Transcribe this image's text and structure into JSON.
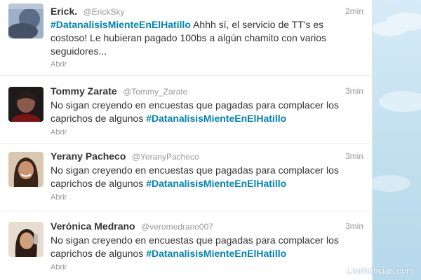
{
  "tweets": [
    {
      "name": "Erick.",
      "handle": "@ErickSky",
      "time": "2min",
      "hashtag": "#DatanalisisMienteEnElHatillo",
      "text_before": "",
      "text_after": " Ahhh sí, el servicio de TT's es costoso! Le hubieran pagado 100bs a algún chamito con varios seguidores...",
      "open_label": "Abrir",
      "avatar_color": "#5b6c86"
    },
    {
      "name": "Tommy Zarate",
      "handle": "@Tommy_Zarate",
      "time": "3min",
      "hashtag": "#DatanalisisMienteEnElHatillo",
      "text_before": "No sigan creyendo en encuestas que pagadas para complacer los caprichos de algunos ",
      "text_after": "",
      "open_label": "Abrir",
      "avatar_color": "#3b2a24"
    },
    {
      "name": "Yerany Pacheco",
      "handle": "@YeranyPacheco",
      "time": "3min",
      "hashtag": "#DatanalisisMienteEnElHatillo",
      "text_before": "No sigan creyendo en encuestas que pagadas para complacer los caprichos de algunos ",
      "text_after": "",
      "open_label": "Abrir",
      "avatar_color": "#a9774f"
    },
    {
      "name": "Verónica Medrano",
      "handle": "@veromedrano007",
      "time": "3min",
      "hashtag": "#DatanalisisMienteEnElHatillo",
      "text_before": "No sigan creyendo en encuestas que pagadas para complacer los caprichos de algunos ",
      "text_after": "",
      "open_label": "Abrir",
      "avatar_color": "#7d5a45"
    }
  ],
  "watermark": "LeaNoticias.com",
  "colors": {
    "hashtag": "#0084b4",
    "name": "#333333",
    "meta": "#999999",
    "background": "#c0deed"
  }
}
